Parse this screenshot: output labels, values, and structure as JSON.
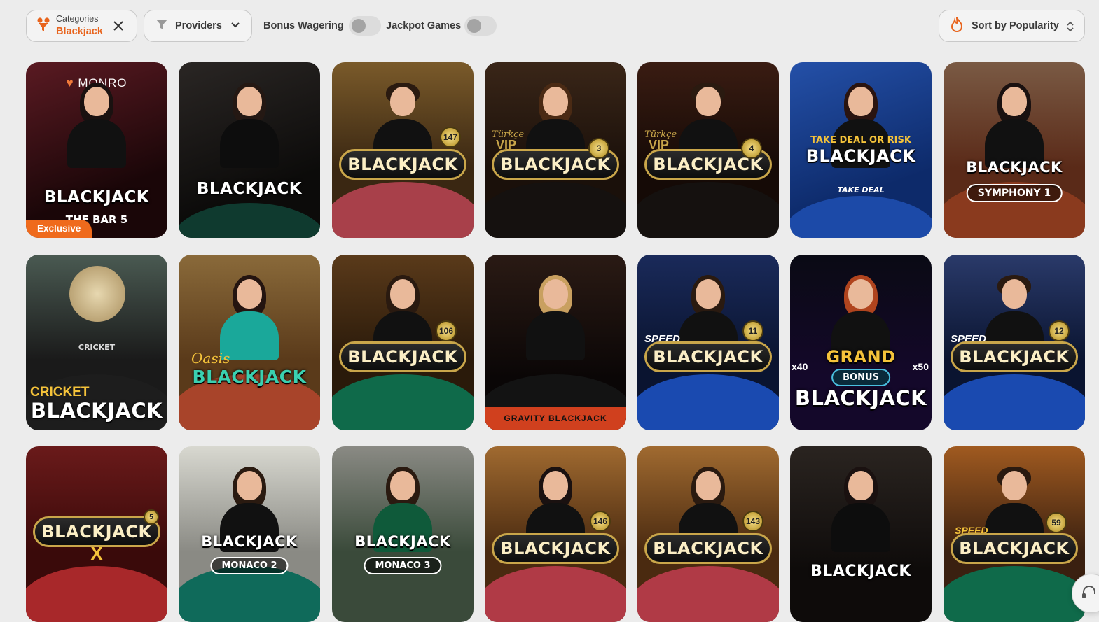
{
  "filters": {
    "category": {
      "label": "Categories",
      "value": "Blackjack",
      "icon": "category-filter-icon",
      "clear_icon": "close-icon"
    },
    "providers": {
      "label": "Providers",
      "icon": "funnel-icon",
      "caret_icon": "chevron-down-icon"
    },
    "toggles": [
      {
        "label": "Bonus Wagering",
        "on": false
      },
      {
        "label": "Jackpot Games",
        "on": false
      }
    ],
    "sort": {
      "label": "Sort by Popularity",
      "icon": "flame-icon",
      "caret_icon": "sort-caret-icon"
    }
  },
  "accent_color": "#e8641d",
  "games": [
    {
      "title": "BLACKJACK",
      "brand": "MONRO",
      "subtitle": "THE BAR 5",
      "badge": "Exclusive"
    },
    {
      "title": "BLACKJACK"
    },
    {
      "title": "BLACKJACK",
      "number": "147"
    },
    {
      "title": "BLACKJACK",
      "prefix": "VIP",
      "script": "Türkçe",
      "number": "3"
    },
    {
      "title": "BLACKJACK",
      "prefix": "VIP",
      "script": "Türkçe",
      "number": "4"
    },
    {
      "title": "BLACKJACK",
      "top": "TAKE DEAL OR RISK",
      "footer": "TAKE DEAL"
    },
    {
      "title": "BLACKJACK",
      "subtitle": "SYMPHONY 1"
    },
    {
      "title": "BLACKJACK",
      "top": "CRICKET",
      "table_text": "CRICKET"
    },
    {
      "title": "BLACKJACK",
      "script": "Oasis"
    },
    {
      "title": "BLACKJACK",
      "number": "106"
    },
    {
      "title": "GRAVITY BLACKJACK"
    },
    {
      "title": "BLACKJACK",
      "prefix": "SPEED",
      "number": "11"
    },
    {
      "title": "BLACKJACK",
      "top": "GRAND",
      "subtitle": "BONUS",
      "left_mult": "x40",
      "right_mult": "x50"
    },
    {
      "title": "BLACKJACK",
      "prefix": "SPEED",
      "number": "12"
    },
    {
      "title": "BLACKJACK",
      "suffix": "X",
      "number": "5"
    },
    {
      "title": "BLACKJACK",
      "subtitle": "MONACO 2"
    },
    {
      "title": "BLACKJACK",
      "subtitle": "MONACO 3"
    },
    {
      "title": "BLACKJACK",
      "number": "146"
    },
    {
      "title": "BLACKJACK",
      "number": "143"
    },
    {
      "title": "BLACKJACK"
    },
    {
      "title": "BLACKJACK",
      "prefix": "SPEED",
      "number": "59"
    }
  ]
}
